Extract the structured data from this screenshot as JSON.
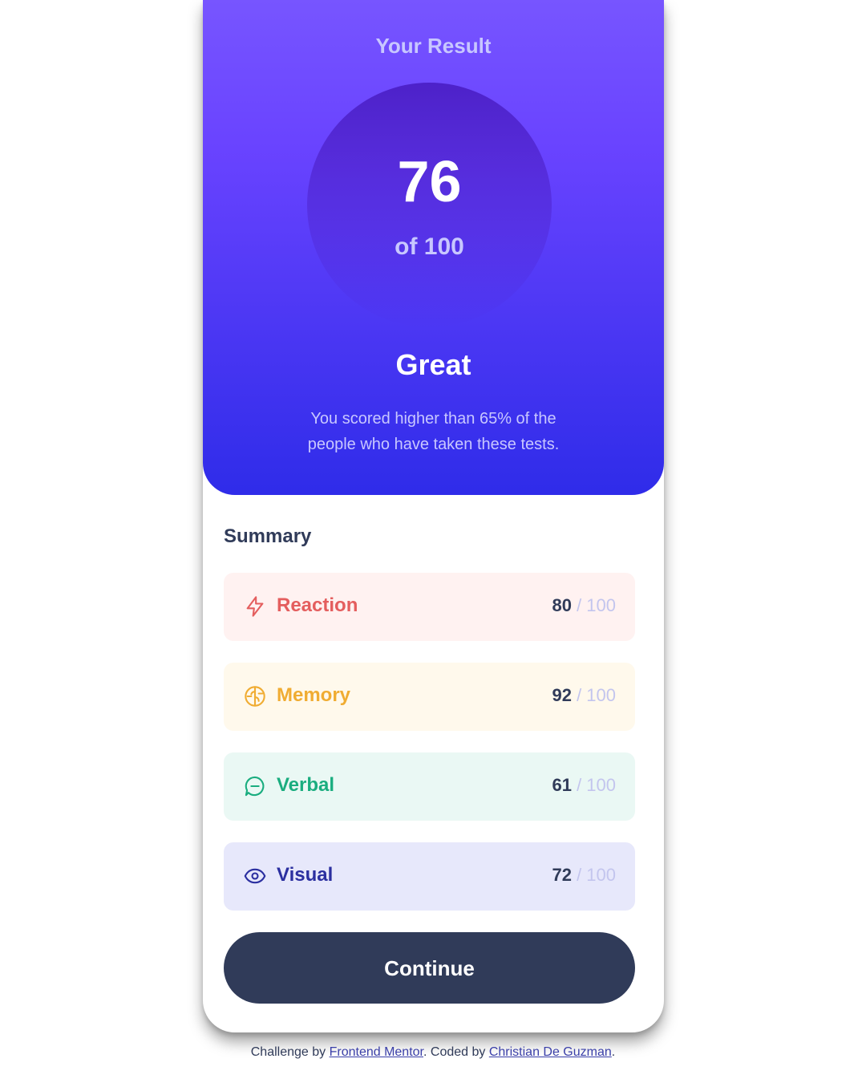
{
  "result": {
    "title": "Your Result",
    "score": "76",
    "of_label": "of 100",
    "rating": "Great",
    "description": "You scored higher than 65% of the people who have taken these tests."
  },
  "summary": {
    "title": "Summary",
    "items": [
      {
        "icon": "lightning-icon",
        "label": "Reaction",
        "score": "80",
        "max": "/ 100",
        "color": "#e45e5e",
        "bg": "#fff2f1"
      },
      {
        "icon": "brain-icon",
        "label": "Memory",
        "score": "92",
        "max": "/ 100",
        "color": "#f0ac32",
        "bg": "#fff9ec"
      },
      {
        "icon": "chat-bubble-icon",
        "label": "Verbal",
        "score": "61",
        "max": "/ 100",
        "color": "#1aad7f",
        "bg": "#eaf8f4"
      },
      {
        "icon": "eye-icon",
        "label": "Visual",
        "score": "72",
        "max": "/ 100",
        "color": "#2b2fa0",
        "bg": "#e7e8fb"
      }
    ]
  },
  "continue_label": "Continue",
  "footer": {
    "prefix": "Challenge by ",
    "link1": "Frontend Mentor",
    "middle": ". Coded by ",
    "link2": "Christian De Guzman",
    "suffix": "."
  },
  "colors": {
    "accent_top": "#7755ff",
    "accent_bottom": "#2f2ce9",
    "button": "#303b59"
  }
}
